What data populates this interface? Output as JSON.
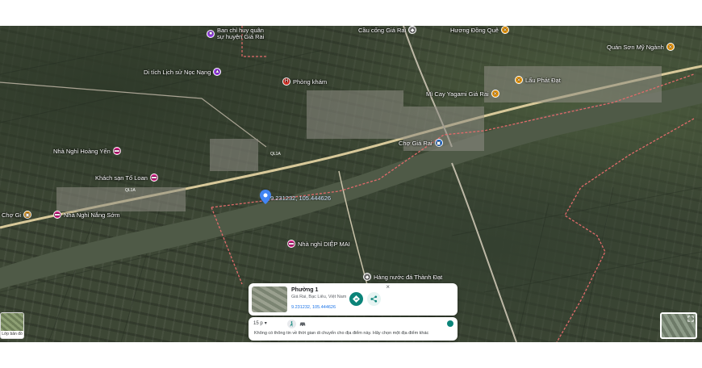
{
  "map": {
    "pois": [
      {
        "label": "Ban chỉ huy quân sự huyện Giá Rai",
        "color": "#a142f4",
        "icon": "office-icon"
      },
      {
        "label": "Di tích Lịch sử Nọc Nạng",
        "color": "#a142f4",
        "icon": "monument-icon"
      },
      {
        "label": "Cầu cống Giá Rai",
        "color": "#8d8d8d",
        "icon": "bridge-icon"
      },
      {
        "label": "Hương Đồng Quê",
        "color": "#f29900",
        "icon": "restaurant-icon"
      },
      {
        "label": "Quán Sơn Mỹ Ngành",
        "color": "#f29900",
        "icon": "restaurant-icon"
      },
      {
        "label": "Lẩu Phát Đạt",
        "color": "#f29900",
        "icon": "restaurant-icon"
      },
      {
        "label": "Phòng khám",
        "color": "#d93025",
        "icon": "hospital-icon"
      },
      {
        "label": "Mì Cay Yagami Giá Rai",
        "color": "#f29900",
        "icon": "restaurant-icon"
      },
      {
        "label": "Chợ Giá Rai",
        "color": "#1a73e8",
        "icon": "market-icon"
      },
      {
        "label": "Nhà Nghỉ Hoàng Yến",
        "color": "#e52592",
        "icon": "hotel-icon"
      },
      {
        "label": "Khách sạn Tố Loan",
        "color": "#e52592",
        "icon": "hotel-icon"
      },
      {
        "label": "Nhà Nghỉ Nắng Sớm",
        "color": "#e52592",
        "icon": "hotel-icon"
      },
      {
        "label": "Chợ Gi",
        "color": "#f29900",
        "icon": "store-icon"
      },
      {
        "label": "Nhà nghỉ DIỆP MAI",
        "color": "#e52592",
        "icon": "hotel-icon"
      },
      {
        "label": "Hàng nước đá Thành Đạt",
        "color": "#8d8d8d",
        "icon": "store-icon"
      }
    ],
    "selected_pin_label": "9.231232, 105.444626",
    "road_label_1": "QL1A",
    "road_label_2": "QL1A"
  },
  "place_card": {
    "name": "Phường 1",
    "address": "Giá Rai, Bạc Liêu, Việt Nam",
    "coords": "9.231232, 105.444626",
    "close": "×"
  },
  "travel": {
    "time": "15 p",
    "note": "Không có thông tin về thời gian di chuyển cho địa điểm này. Hãy chọn một địa điểm khác"
  },
  "layers": {
    "label": "Lớp bản đồ"
  },
  "colors": {
    "accent": "#0b8479",
    "boundary": "#e26b6b",
    "river": "#55614e",
    "road": "#d8c99a"
  }
}
